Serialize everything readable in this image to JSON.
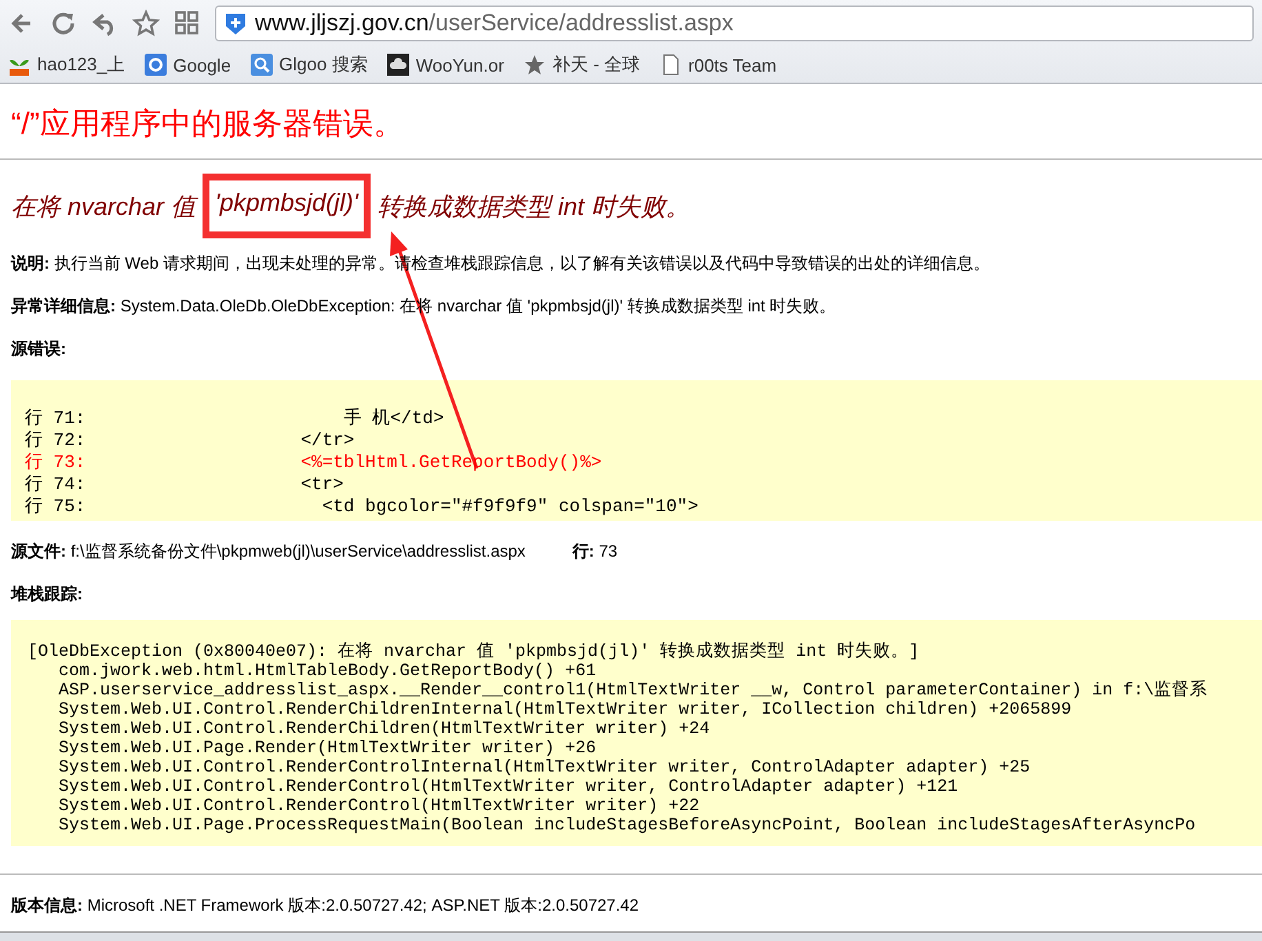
{
  "toolbar": {
    "url_host": "www.jljszj.gov.cn",
    "url_path": "/userService/addresslist.aspx"
  },
  "bookmarks": [
    {
      "label": "hao123_上",
      "kind": "sprout"
    },
    {
      "label": "Google",
      "kind": "letter-tile"
    },
    {
      "label": "Glgoo 搜索",
      "kind": "search"
    },
    {
      "label": "WooYun.or",
      "kind": "cloud"
    },
    {
      "label": "补天 - 全球",
      "kind": "star"
    },
    {
      "label": "r00ts Team",
      "kind": "page"
    }
  ],
  "page": {
    "title": "“/”应用程序中的服务器错误。",
    "error_message": {
      "before": "在将 nvarchar 值 ",
      "highlighted": "'pkpmbsjd(jl)'",
      "after": " 转换成数据类型 int 时失败。"
    },
    "description": "**说明:** 执行当前 Web 请求期间，出现未处理的异常。请检查堆栈跟踪信息，以了解有关该错误以及代码中导致错误的出处的详细信息。",
    "exception_details": "**异常详细信息:** System.Data.OleDb.OleDbException: 在将 nvarchar 值 'pkpmbsjd(jl)' 转换成数据类型 int 时失败。",
    "source_error_heading": "源错误:",
    "source_lines": [
      {
        "text": "行 71:                        手 机</td>",
        "highlighted": false
      },
      {
        "text": "行 72:                    </tr>",
        "highlighted": false
      },
      {
        "text": "行 73:                    <%=tblHtml.GetReportBody()%>",
        "highlighted": true
      },
      {
        "text": "行 74:                    <tr>",
        "highlighted": false
      },
      {
        "text": "行 75:                      <td bgcolor=\"#f9f9f9\" colspan=\"10\">",
        "highlighted": false
      }
    ],
    "source_file": "**源文件:** f:\\监督系统备份文件\\pkpmweb(jl)\\userService\\addresslist.aspx",
    "source_line": "**行:** 73",
    "stack_heading": "堆栈跟踪:",
    "stack_lines": [
      "[OleDbException (0x80040e07): 在将 nvarchar 值 'pkpmbsjd(jl)' 转换成数据类型 int 时失败。]",
      "   com.jwork.web.html.HtmlTableBody.GetReportBody() +61",
      "   ASP.userservice_addresslist_aspx.__Render__control1(HtmlTextWriter __w, Control parameterContainer) in f:\\监督系",
      "   System.Web.UI.Control.RenderChildrenInternal(HtmlTextWriter writer, ICollection children) +2065899",
      "   System.Web.UI.Control.RenderChildren(HtmlTextWriter writer) +24",
      "   System.Web.UI.Page.Render(HtmlTextWriter writer) +26",
      "   System.Web.UI.Control.RenderControlInternal(HtmlTextWriter writer, ControlAdapter adapter) +25",
      "   System.Web.UI.Control.RenderControl(HtmlTextWriter writer, ControlAdapter adapter) +121",
      "   System.Web.UI.Control.RenderControl(HtmlTextWriter writer) +22",
      "   System.Web.UI.Page.ProcessRequestMain(Boolean includeStagesBeforeAsyncPoint, Boolean includeStagesAfterAsyncPo"
    ],
    "version_info": "**版本信息:** Microsoft .NET Framework 版本:2.0.50727.42; ASP.NET 版本:2.0.50727.42"
  }
}
